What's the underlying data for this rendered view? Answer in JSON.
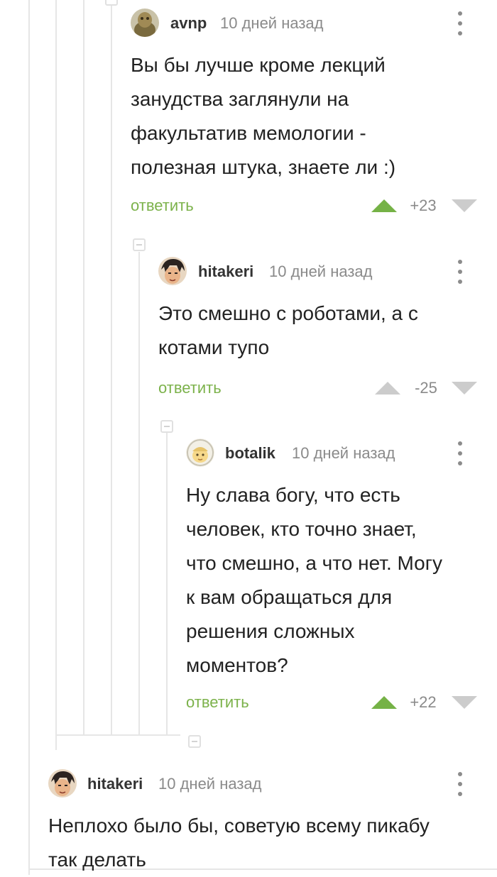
{
  "comments": [
    {
      "author": "avnp",
      "time": "10 дней назад",
      "text_lines": [
        "Вы бы лучше кроме лекций",
        "занудства заглянули на",
        "факультатив мемологии -",
        "полезная штука, знаете ли :)"
      ],
      "reply_label": "ответить",
      "score": "+23",
      "upvoted": true
    },
    {
      "author": "hitakeri",
      "time": "10 дней назад",
      "text_lines": [
        "Это смешно с роботами, а с",
        "котами тупо"
      ],
      "reply_label": "ответить",
      "score": "-25",
      "upvoted": false
    },
    {
      "author": "botalik",
      "time": "10 дней назад",
      "text_lines": [
        "Ну слава богу, что есть",
        "человек, кто точно знает,",
        "что смешно, а что нет. Могу",
        "к вам обращаться для",
        "решения сложных",
        "моментов?"
      ],
      "reply_label": "ответить",
      "score": "+22",
      "upvoted": true
    },
    {
      "author": "hitakeri",
      "time": "10 дней назад",
      "text_lines": [
        "Неплохо было бы, советую всему пикабу",
        "так делать"
      ]
    }
  ],
  "colors": {
    "accent_green": "#75b246",
    "reply_green": "#7cb24b",
    "thread_line": "#e6e6e6",
    "vote_inactive": "#cccccc"
  },
  "icons": {
    "upvote": "triangle-up-icon",
    "downvote": "triangle-down-icon",
    "menu": "more-vertical-icon",
    "collapse": "minus-square-icon"
  }
}
